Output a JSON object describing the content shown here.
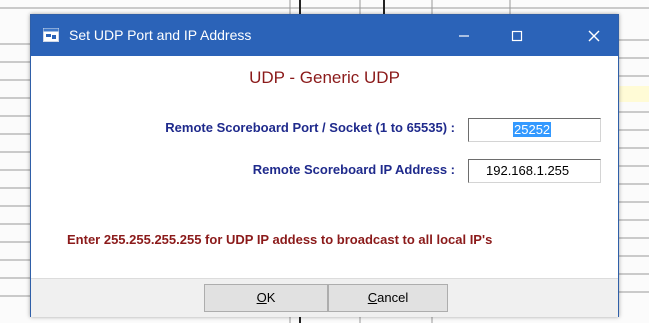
{
  "dialog": {
    "title": "Set UDP Port and IP Address",
    "heading": "UDP - Generic UDP",
    "port_label": "Remote Scoreboard Port / Socket (1 to 65535) :",
    "port_value": "25252",
    "ip_label": "Remote Scoreboard IP Address :",
    "ip_value": "192.168.1.255",
    "hint": "Enter 255.255.255.255 for UDP IP addess to broadcast to all local IP's",
    "ok_mnemonic": "O",
    "ok_rest": "K",
    "cancel_mnemonic": "C",
    "cancel_rest": "ancel"
  },
  "icons": {
    "app": "app-window-icon",
    "minimize": "minimize-icon",
    "maximize": "maximize-icon",
    "close": "close-icon"
  },
  "colors": {
    "titlebar": "#2b63b8",
    "heading": "#8b1a1a",
    "label": "#1f2a8c",
    "selection": "#3399ff"
  }
}
